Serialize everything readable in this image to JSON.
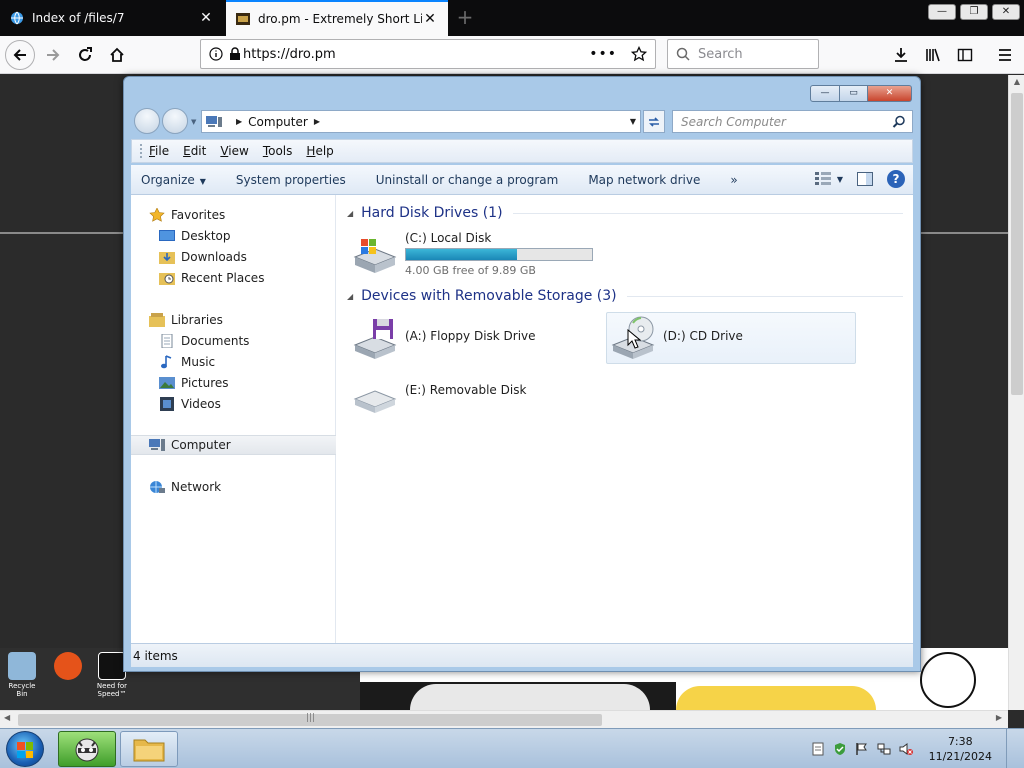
{
  "browser": {
    "tabs": [
      {
        "label": "Index of /files/7",
        "active": false
      },
      {
        "label": "dro.pm - Extremely Short Links",
        "active": true
      }
    ],
    "new_tab_symbol": "+",
    "url": "https://dro.pm",
    "url_actions": "•••",
    "search_placeholder": "Search",
    "window_controls": {
      "minimize": "—",
      "restore": "❐",
      "close": "✕"
    }
  },
  "explorer": {
    "window_controls": {
      "minimize": "—",
      "maximize": "▭",
      "close": "✕"
    },
    "address": {
      "crumb": "Computer"
    },
    "search_placeholder": "Search Computer",
    "menu": [
      {
        "label": "File",
        "key": "F"
      },
      {
        "label": "Edit",
        "key": "E"
      },
      {
        "label": "View",
        "key": "V"
      },
      {
        "label": "Tools",
        "key": "T"
      },
      {
        "label": "Help",
        "key": "H"
      }
    ],
    "commands": {
      "organize": "Organize",
      "system_properties": "System properties",
      "uninstall": "Uninstall or change a program",
      "map_drive": "Map network drive",
      "more": "»"
    },
    "nav": {
      "favorites": "Favorites",
      "desktop": "Desktop",
      "downloads": "Downloads",
      "recent": "Recent Places",
      "libraries": "Libraries",
      "documents": "Documents",
      "music": "Music",
      "pictures": "Pictures",
      "videos": "Videos",
      "computer": "Computer",
      "network": "Network"
    },
    "groups": {
      "hdd": "Hard Disk Drives (1)",
      "removable": "Devices with Removable Storage (3)"
    },
    "drives": {
      "c": {
        "name": "(C:) Local Disk",
        "free_text": "4.00 GB free of 9.89 GB",
        "used_fraction": 0.596
      },
      "a": {
        "name": "(A:) Floppy Disk Drive"
      },
      "d": {
        "name": "(D:) CD Drive"
      },
      "e": {
        "name": "(E:) Removable Disk"
      }
    },
    "status": "4 items"
  },
  "desktop_strip": {
    "recycle_label": "Recycle Bin",
    "nfs_label": "Need for Speed™"
  },
  "taskbar": {
    "time": "7:38",
    "date": "11/21/2024"
  },
  "colors": {
    "accent": "#0a84ff",
    "win_frame": "#a9c9e8",
    "group_header": "#1e3287",
    "progress": "#1a87b6"
  }
}
